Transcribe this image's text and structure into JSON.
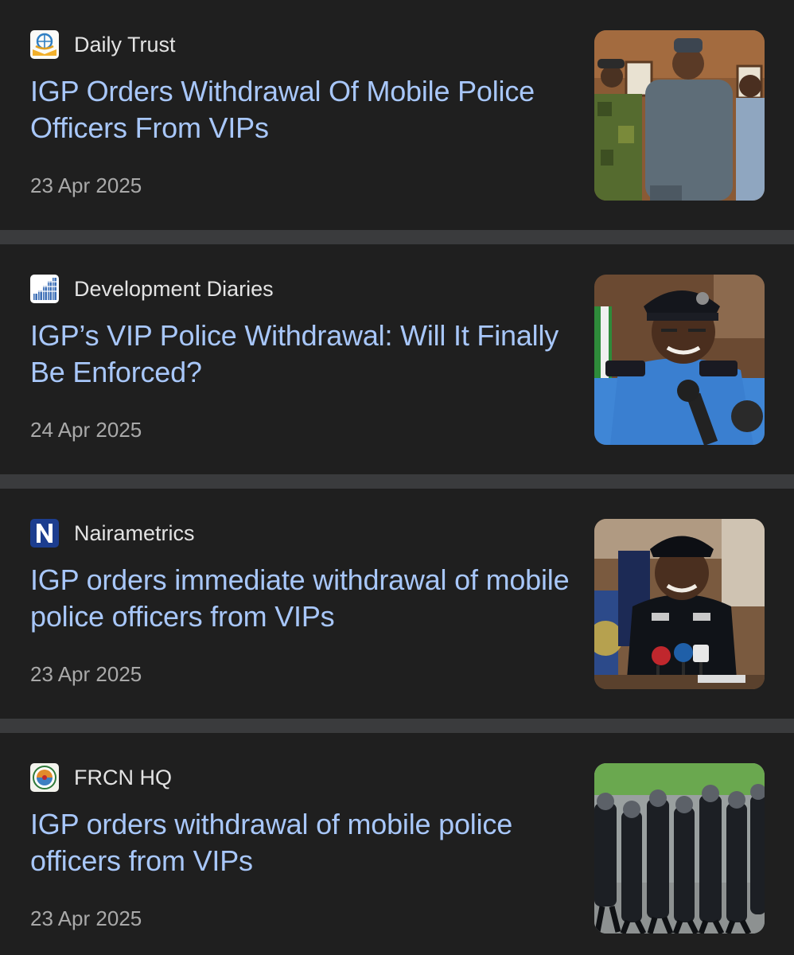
{
  "articles": [
    {
      "source": "Daily Trust",
      "source_icon": "daily-trust-logo-icon",
      "headline": "IGP Orders Withdrawal Of Mobile Police Officers From VIPs",
      "date": "23 Apr 2025",
      "thumbnail": "officials-group-photo-image"
    },
    {
      "source": "Development Diaries",
      "source_icon": "development-diaries-logo-icon",
      "headline": "IGP’s VIP Police Withdrawal: Will It Finally Be Enforced?",
      "date": "24 Apr 2025",
      "thumbnail": "police-chief-speaking-image"
    },
    {
      "source": "Nairametrics",
      "source_icon": "nairametrics-logo-icon",
      "headline": "IGP orders immediate withdrawal of mobile police officers from VIPs",
      "date": "23 Apr 2025",
      "thumbnail": "police-chief-press-briefing-image"
    },
    {
      "source": "FRCN HQ",
      "source_icon": "frcn-logo-icon",
      "headline": "IGP orders withdrawal of mobile police officers from VIPs",
      "date": "23 Apr 2025",
      "thumbnail": "mobile-police-parade-image"
    }
  ],
  "colors": {
    "card_background": "#1f1f1f",
    "separator": "#3a3b3d",
    "headline": "#a8c7fa",
    "source_text": "#e3e3e3",
    "date_text": "#a9a9a9"
  }
}
